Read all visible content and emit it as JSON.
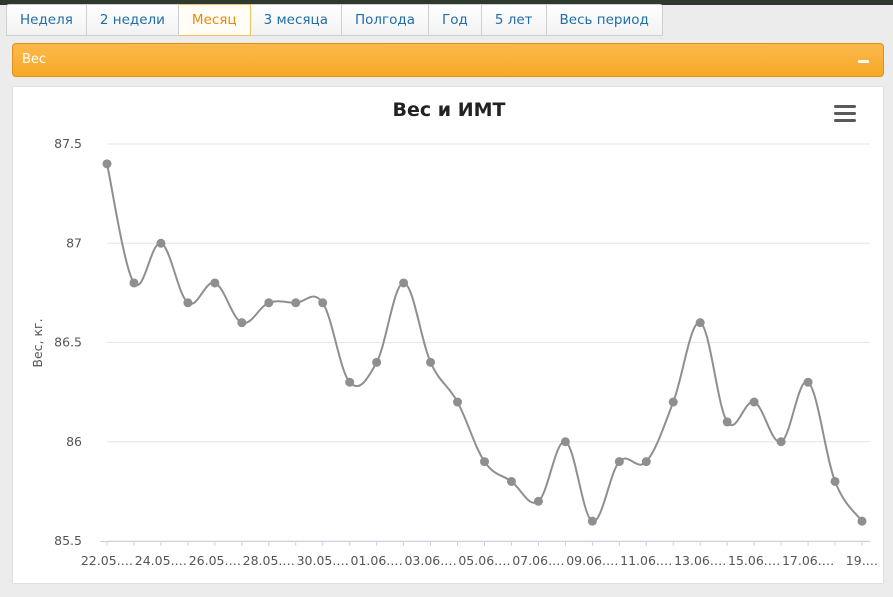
{
  "tabs": [
    {
      "label": "Неделя",
      "active": false
    },
    {
      "label": "2 недели",
      "active": false
    },
    {
      "label": "Месяц",
      "active": true
    },
    {
      "label": "3 месяца",
      "active": false
    },
    {
      "label": "Полгода",
      "active": false
    },
    {
      "label": "Год",
      "active": false
    },
    {
      "label": "5 лет",
      "active": false
    },
    {
      "label": "Весь период",
      "active": false
    }
  ],
  "panel": {
    "title": "Вес"
  },
  "colors": {
    "accent": "#f7a928",
    "series": "#8f8f8f",
    "tab_text": "#1f6ea8",
    "tab_active": "#e48b0c"
  },
  "icons": {
    "menu": "hamburger-menu-icon",
    "collapse": "minus-icon"
  },
  "chart_data": {
    "type": "line",
    "title": "Вес и ИМТ",
    "xlabel": "",
    "ylabel": "Вес, кг.",
    "ylim": [
      85.5,
      87.5
    ],
    "yticks": [
      "87.5",
      "87",
      "86.5",
      "86",
      "85.5"
    ],
    "x_tick_labels": [
      "22.05.…",
      "24.05.…",
      "26.05.…",
      "28.05.…",
      "30.05.…",
      "01.06.…",
      "03.06.…",
      "05.06.…",
      "07.06.…",
      "09.06.…",
      "11.06.…",
      "13.06.…",
      "15.06.…",
      "17.06.…",
      "19.…"
    ],
    "grid": true,
    "series": [
      {
        "values": [
          87.4,
          86.8,
          87.0,
          86.7,
          86.8,
          86.6,
          86.7,
          86.7,
          86.7,
          86.3,
          86.4,
          86.8,
          86.4,
          86.2,
          85.9,
          85.8,
          85.7,
          86.0,
          85.6,
          85.9,
          85.9,
          86.2,
          86.6,
          86.1,
          86.2,
          86.0,
          86.3,
          85.8,
          85.6
        ]
      }
    ]
  }
}
